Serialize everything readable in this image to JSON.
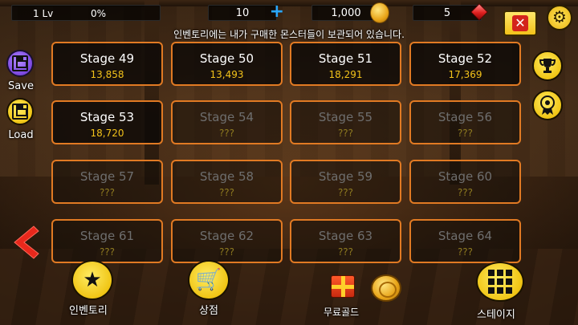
{
  "top_bar": {
    "level": "1 Lv",
    "exp_percent": "0%",
    "energy": "10",
    "gold": "1,000",
    "gems": "5"
  },
  "info_message": "인벤토리에는 내가 구매한 몬스터들이 보관되어 있습니다.",
  "side_buttons": {
    "save_label": "Save",
    "load_label": "Load"
  },
  "stages": [
    {
      "name": "Stage 49",
      "score": "13,858",
      "locked": false
    },
    {
      "name": "Stage 50",
      "score": "13,493",
      "locked": false
    },
    {
      "name": "Stage 51",
      "score": "18,291",
      "locked": false
    },
    {
      "name": "Stage 52",
      "score": "17,369",
      "locked": false
    },
    {
      "name": "Stage 53",
      "score": "18,720",
      "locked": false
    },
    {
      "name": "Stage 54",
      "score": "???",
      "locked": true
    },
    {
      "name": "Stage 55",
      "score": "???",
      "locked": true
    },
    {
      "name": "Stage 56",
      "score": "???",
      "locked": true
    },
    {
      "name": "Stage 57",
      "score": "???",
      "locked": true
    },
    {
      "name": "Stage 58",
      "score": "???",
      "locked": true
    },
    {
      "name": "Stage 59",
      "score": "???",
      "locked": true
    },
    {
      "name": "Stage 60",
      "score": "???",
      "locked": true
    },
    {
      "name": "Stage 61",
      "score": "???",
      "locked": true
    },
    {
      "name": "Stage 62",
      "score": "???",
      "locked": true
    },
    {
      "name": "Stage 63",
      "score": "???",
      "locked": true
    },
    {
      "name": "Stage 64",
      "score": "???",
      "locked": true
    }
  ],
  "bottom_bar": {
    "inventory_label": "인벤토리",
    "shop_label": "상점",
    "free_gold_label": "무료골드",
    "stage_label": "스테이지"
  },
  "colors": {
    "accent_yellow": "#f2c21a",
    "cell_border": "#e17a23",
    "close_red": "#d3241c",
    "save_purple": "#7a46e0"
  },
  "icons": [
    "plus-icon",
    "gold-coin-icon",
    "gem-icon",
    "close-icon",
    "gear-icon",
    "trophy-icon",
    "medal-icon",
    "floppy-disk-icon",
    "left-arrow-icon",
    "star-icon",
    "cart-icon",
    "gift-box-icon",
    "grid-icon"
  ]
}
